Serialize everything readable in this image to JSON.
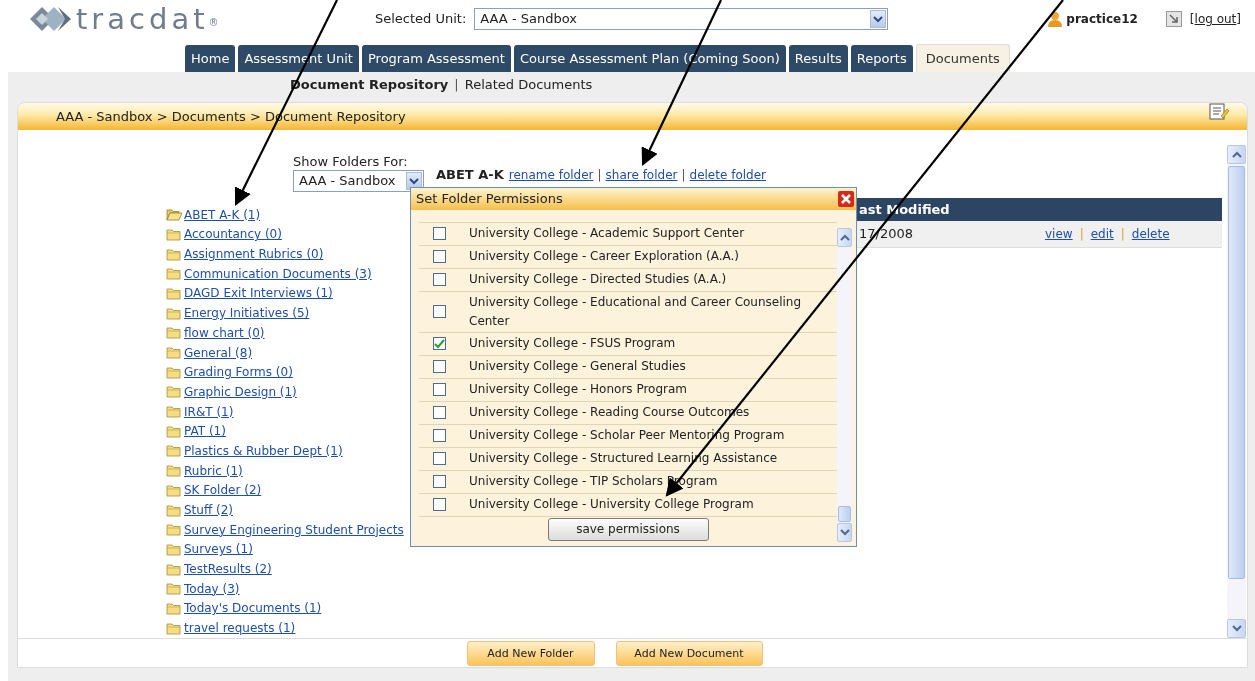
{
  "header": {
    "logo": {
      "text": "tracdat",
      "mark": "®"
    },
    "unit_label": "Selected Unit:",
    "unit_value": "AAA - Sandbox",
    "user": "practice12",
    "logout": {
      "label": "log out",
      "open": "[",
      "close": "]"
    }
  },
  "tabs": [
    {
      "label": "Home",
      "selected": false
    },
    {
      "label": "Assessment Unit",
      "selected": false
    },
    {
      "label": "Program Assessment",
      "selected": false
    },
    {
      "label": "Course Assessment Plan (Coming Soon)",
      "selected": false
    },
    {
      "label": "Results",
      "selected": false
    },
    {
      "label": "Reports",
      "selected": false
    },
    {
      "label": "Documents",
      "selected": true
    }
  ],
  "subnav": {
    "separator": "|",
    "items": [
      {
        "label": "Document Repository",
        "selected": true
      },
      {
        "label": "Related Documents",
        "selected": false
      }
    ]
  },
  "breadcrumb": "AAA - Sandbox > Documents > Document Repository",
  "folder_filter": {
    "label": "Show Folders For:",
    "value": "AAA - Sandbox"
  },
  "folder_header": {
    "name": "ABET A-K",
    "separator": "|",
    "actions": [
      "rename folder",
      "share folder",
      "delete folder"
    ]
  },
  "folders": [
    {
      "label": "ABET A-K (1)",
      "expanded": true
    },
    {
      "label": "Accountancy (0)",
      "expanded": false
    },
    {
      "label": "Assignment Rubrics (0)",
      "expanded": false
    },
    {
      "label": "Communication Documents (3)",
      "expanded": false
    },
    {
      "label": "DAGD Exit Interviews (1)",
      "expanded": false
    },
    {
      "label": "Energy Initiatives (5)",
      "expanded": false
    },
    {
      "label": "flow chart (0)",
      "expanded": false
    },
    {
      "label": "General (8)",
      "expanded": false
    },
    {
      "label": "Grading Forms (0)",
      "expanded": false
    },
    {
      "label": "Graphic Design (1)",
      "expanded": false
    },
    {
      "label": "IR&T (1)",
      "expanded": false
    },
    {
      "label": "PAT (1)",
      "expanded": false
    },
    {
      "label": "Plastics & Rubber Dept (1)",
      "expanded": false
    },
    {
      "label": "Rubric (1)",
      "expanded": false
    },
    {
      "label": "SK Folder (2)",
      "expanded": false
    },
    {
      "label": "Stuff (2)",
      "expanded": false
    },
    {
      "label": "Survey Engineering Student Projects",
      "expanded": false
    },
    {
      "label": "Surveys (1)",
      "expanded": false
    },
    {
      "label": "TestResults (2)",
      "expanded": false
    },
    {
      "label": "Today (3)",
      "expanded": false
    },
    {
      "label": "Today's Documents (1)",
      "expanded": false
    },
    {
      "label": "travel requests (1)",
      "expanded": false
    }
  ],
  "documents_table": {
    "columns": [
      "ast Modified"
    ],
    "separator": "|",
    "rows": [
      {
        "cells": [
          "17/2008"
        ],
        "actions": [
          "view",
          "edit",
          "delete"
        ]
      }
    ]
  },
  "dialog": {
    "title": "Set Folder Permissions",
    "items": [
      {
        "label": "University College - Academic Support Center",
        "checked": false
      },
      {
        "label": "University College - Career Exploration (A.A.)",
        "checked": false
      },
      {
        "label": "University College - Directed Studies (A.A.)",
        "checked": false
      },
      {
        "label": "University College - Educational and Career Counseling Center",
        "checked": false
      },
      {
        "label": "University College - FSUS Program",
        "checked": true
      },
      {
        "label": "University College - General Studies",
        "checked": false
      },
      {
        "label": "University College - Honors Program",
        "checked": false
      },
      {
        "label": "University College - Reading Course Outcomes",
        "checked": false
      },
      {
        "label": "University College - Scholar Peer Mentoring Program",
        "checked": false
      },
      {
        "label": "University College - Structured Learning Assistance",
        "checked": false
      },
      {
        "label": "University College - TIP Scholars Program",
        "checked": false
      },
      {
        "label": "University College - University College Program",
        "checked": false
      }
    ],
    "save": "save permissions"
  },
  "footer_buttons": [
    "Add New Folder",
    "Add New Document"
  ]
}
